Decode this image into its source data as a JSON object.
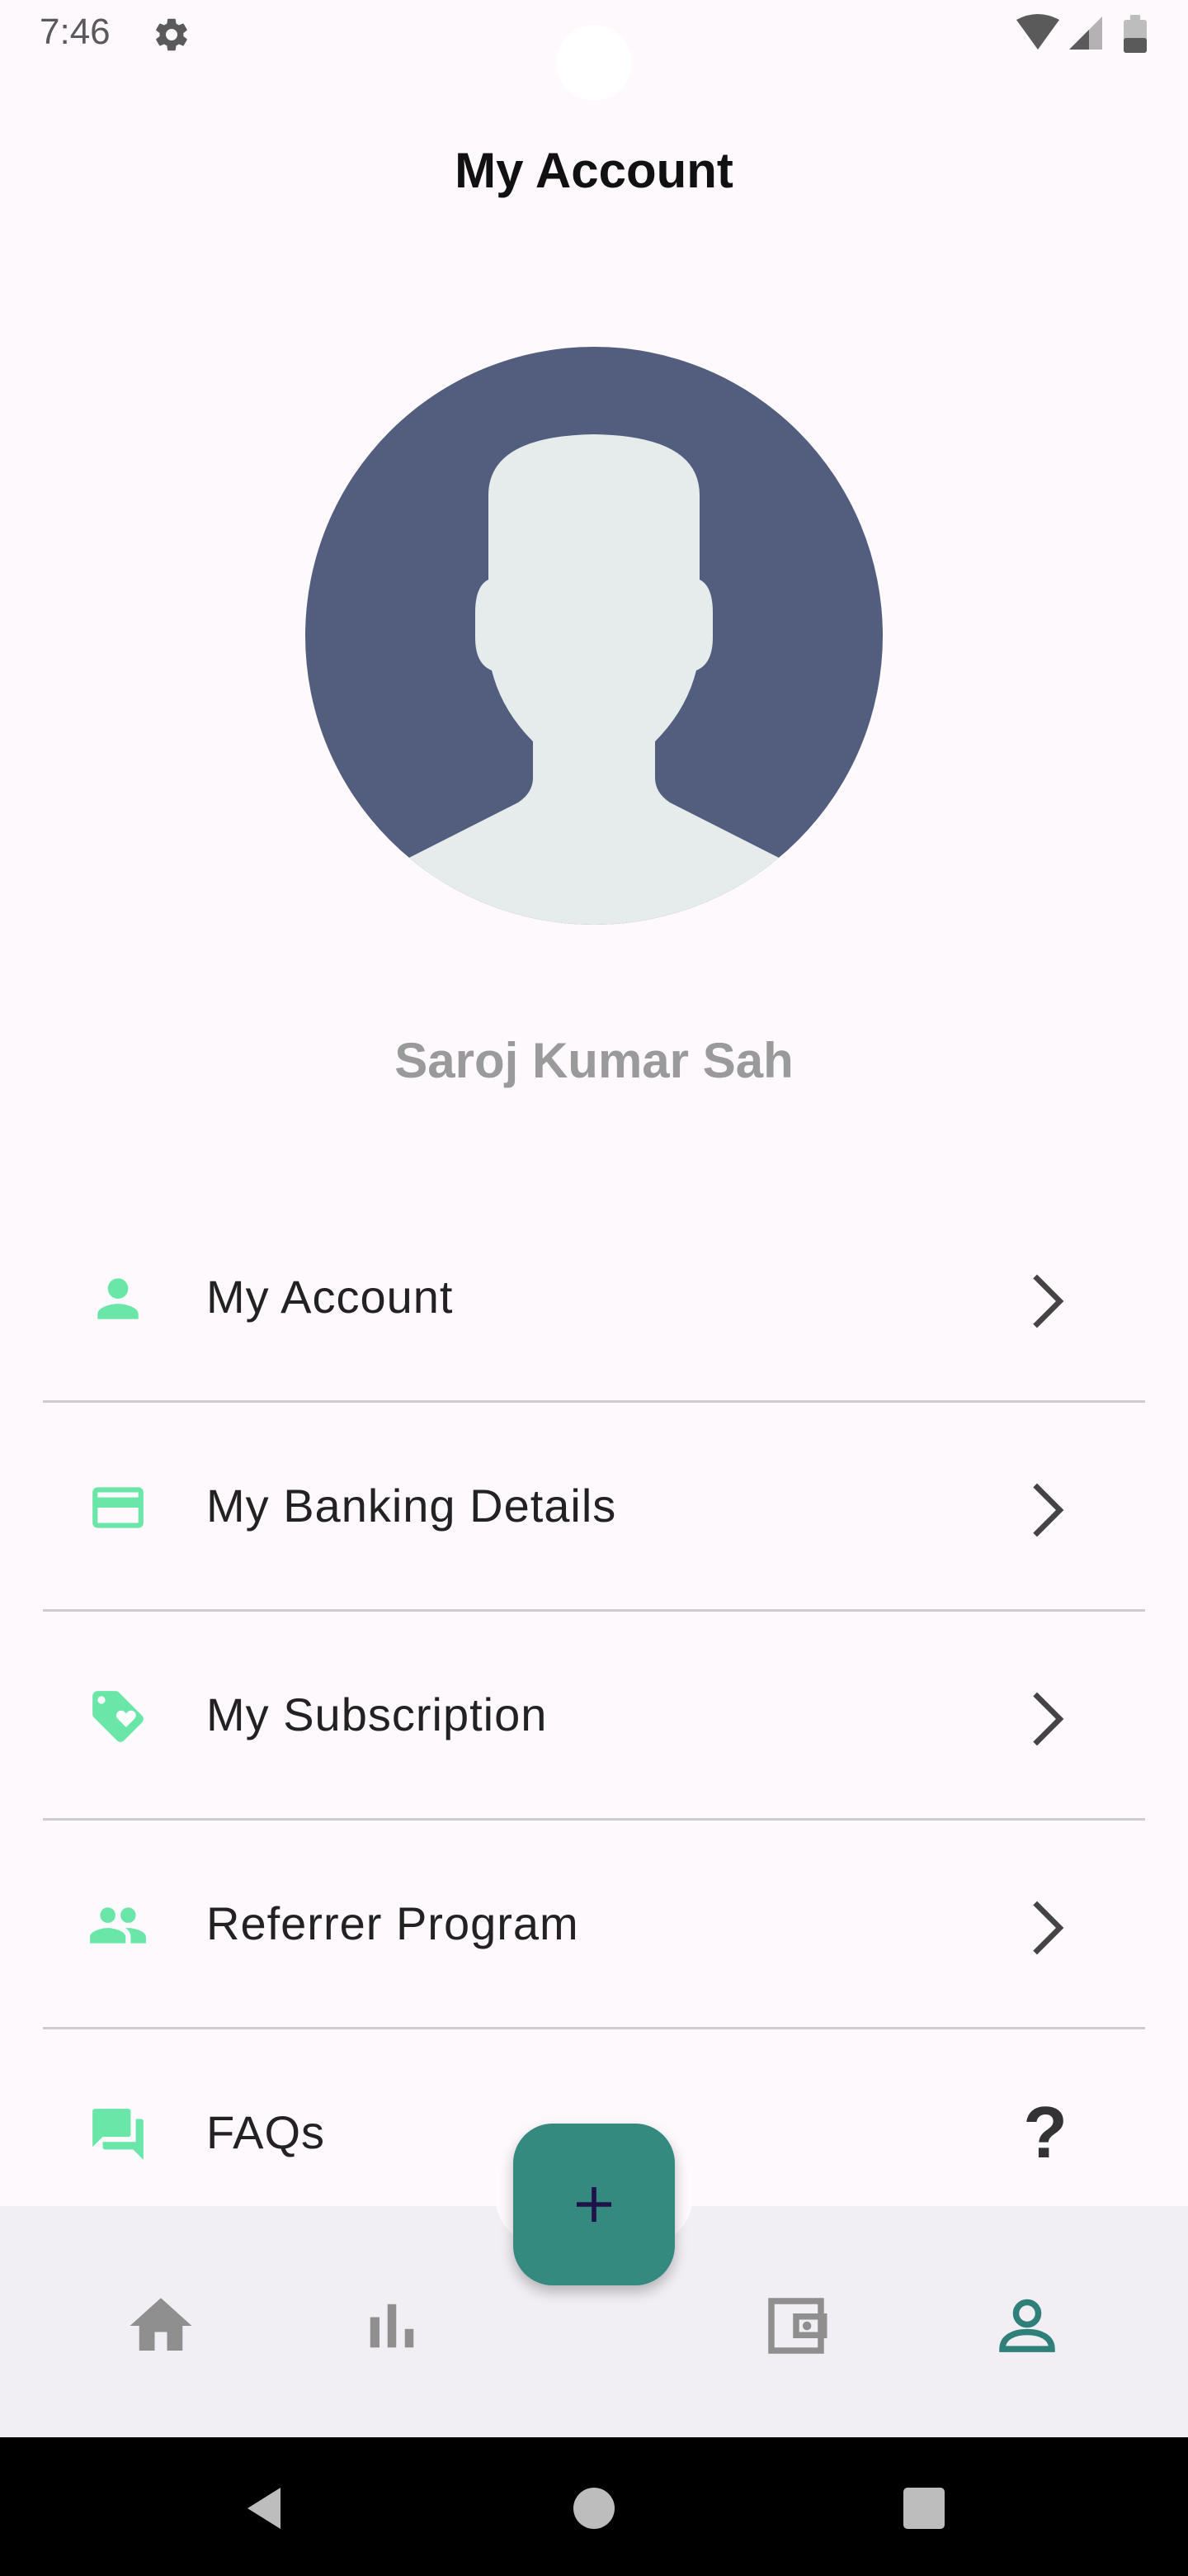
{
  "status_bar": {
    "time": "7:46",
    "icons": [
      "settings-icon",
      "wifi-icon",
      "signal-icon",
      "battery-icon"
    ]
  },
  "header": {
    "title": "My Account"
  },
  "profile": {
    "name": "Saroj Kumar Sah",
    "avatar_bg_color": "#535e7e",
    "avatar_fg_color": "#e6ebeb"
  },
  "menu": {
    "accent_color": "#6ae6a8",
    "items": [
      {
        "label": "My Account",
        "icon": "person-icon",
        "trailing": "chevron-right-icon"
      },
      {
        "label": "My Banking Details",
        "icon": "credit-card-icon",
        "trailing": "chevron-right-icon"
      },
      {
        "label": "My Subscription",
        "icon": "tag-heart-icon",
        "trailing": "chevron-right-icon"
      },
      {
        "label": "Referrer Program",
        "icon": "people-icon",
        "trailing": "chevron-right-icon"
      },
      {
        "label": "FAQs",
        "icon": "forum-icon",
        "trailing_text": "?"
      }
    ]
  },
  "bottom_nav": {
    "active_color": "#2f8079",
    "inactive_color": "#8f8f8f",
    "items": [
      "home-icon",
      "bar-chart-icon",
      "add-icon",
      "wallet-icon",
      "profile-icon"
    ],
    "active": "profile-icon",
    "fab_color": "#358a80"
  },
  "system_nav": {
    "items": [
      "back-icon",
      "home-circle-icon",
      "recents-icon"
    ]
  }
}
